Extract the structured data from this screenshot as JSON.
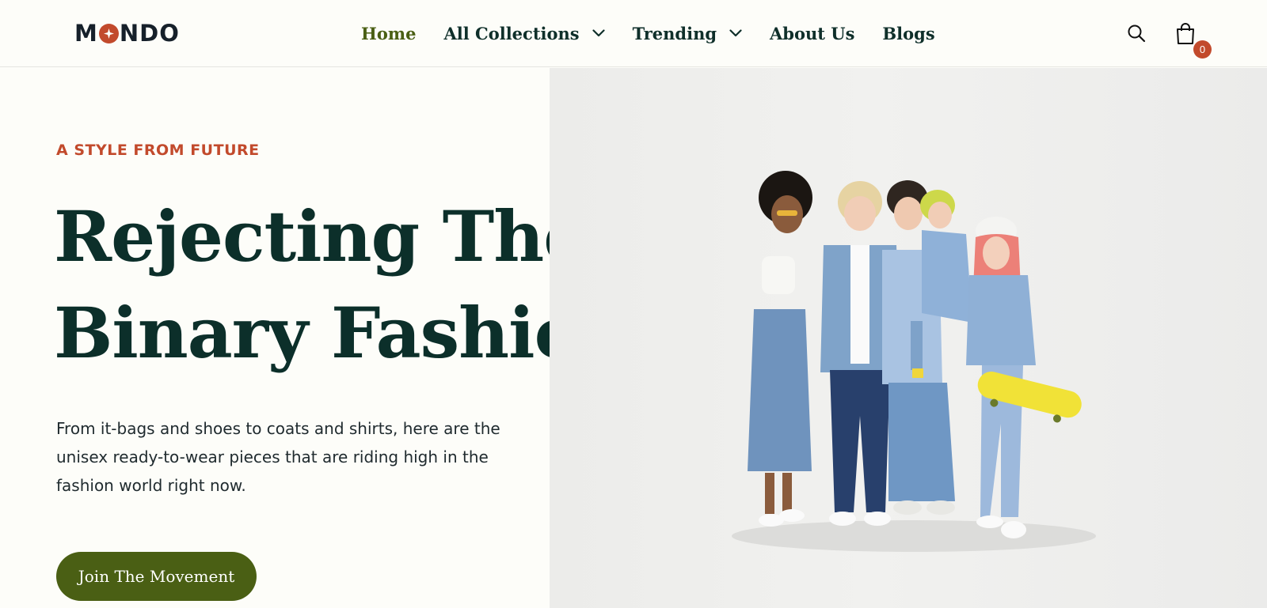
{
  "brand": {
    "name_before": "M",
    "name_after": "NDO"
  },
  "nav": {
    "items": [
      {
        "label": "Home",
        "active": true,
        "has_dropdown": false
      },
      {
        "label": "All Collections",
        "active": false,
        "has_dropdown": true
      },
      {
        "label": "Trending",
        "active": false,
        "has_dropdown": true
      },
      {
        "label": "About Us",
        "active": false,
        "has_dropdown": false
      },
      {
        "label": "Blogs",
        "active": false,
        "has_dropdown": false
      }
    ]
  },
  "header_actions": {
    "search_icon": "search-icon",
    "cart_icon": "shopping-bag-icon",
    "cart_count": "0"
  },
  "hero": {
    "eyebrow": "A STYLE FROM FUTURE",
    "headline_line1": "Rejecting The",
    "headline_line2": "Binary Fashion",
    "lead_line1": "From it-bags and shoes to coats and shirts, here are the",
    "lead_line2": "unisex ready-to-wear pieces that are riding high in the",
    "lead_line3": "fashion world right now.",
    "cta_label": "Join The Movement"
  },
  "colors": {
    "accent": "#c24a2c",
    "brand_green": "#4a5f14",
    "heading": "#0c2f2a",
    "background": "#fdfdf9"
  }
}
